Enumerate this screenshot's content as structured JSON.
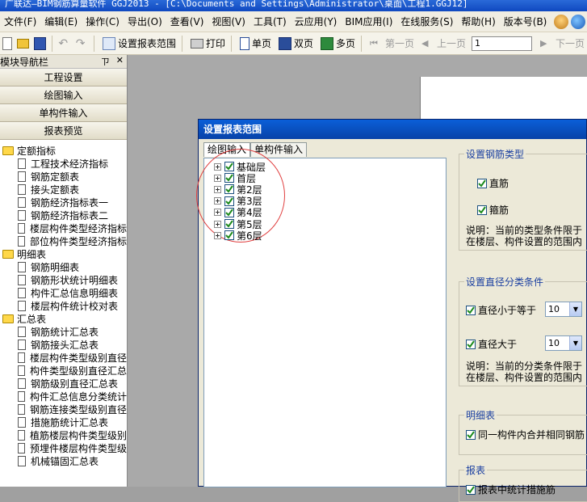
{
  "window": {
    "title": "广联达—BIM钢筋算量软件 GGJ2013 - [C:\\Documents and Settings\\Administrator\\桌面\\工程1.GGJ12]"
  },
  "menu": [
    "文件(F)",
    "编辑(E)",
    "操作(C)",
    "导出(O)",
    "查看(V)",
    "视图(V)",
    "工具(T)",
    "云应用(Y)",
    "BIM应用(I)",
    "在线服务(S)",
    "帮助(H)",
    "版本号(B)"
  ],
  "toolbar": {
    "set_range": "设置报表范围",
    "print": "打印",
    "single_page": "单页",
    "double_page": "双页",
    "multi_page": "多页",
    "first_page": "第一页",
    "prev_page": "上一页",
    "page_number": "1",
    "next_page": "下一页"
  },
  "nav": {
    "title": "模块导航栏",
    "pin": "ㄗ",
    "close": "✕",
    "buttons": [
      "工程设置",
      "绘图输入",
      "单构件输入",
      "报表预览"
    ],
    "tree": [
      {
        "type": "folder",
        "label": "定额指标"
      },
      {
        "type": "leaf",
        "label": "工程技术经济指标"
      },
      {
        "type": "leaf",
        "label": "钢筋定额表"
      },
      {
        "type": "leaf",
        "label": "接头定额表"
      },
      {
        "type": "leaf",
        "label": "钢筋经济指标表一"
      },
      {
        "type": "leaf",
        "label": "钢筋经济指标表二"
      },
      {
        "type": "leaf",
        "label": "楼层构件类型经济指标"
      },
      {
        "type": "leaf",
        "label": "部位构件类型经济指标"
      },
      {
        "type": "folder",
        "label": "明细表"
      },
      {
        "type": "leaf",
        "label": "钢筋明细表"
      },
      {
        "type": "leaf",
        "label": "钢筋形状统计明细表"
      },
      {
        "type": "leaf",
        "label": "构件汇总信息明细表"
      },
      {
        "type": "leaf",
        "label": "楼层构件统计校对表"
      },
      {
        "type": "folder",
        "label": "汇总表"
      },
      {
        "type": "leaf",
        "label": "钢筋统计汇总表"
      },
      {
        "type": "leaf",
        "label": "钢筋接头汇总表"
      },
      {
        "type": "leaf",
        "label": "楼层构件类型级别直径"
      },
      {
        "type": "leaf",
        "label": "构件类型级别直径汇总"
      },
      {
        "type": "leaf",
        "label": "钢筋级别直径汇总表"
      },
      {
        "type": "leaf",
        "label": "构件汇总信息分类统计"
      },
      {
        "type": "leaf",
        "label": "钢筋连接类型级别直径"
      },
      {
        "type": "leaf",
        "label": "措施筋统计汇总表"
      },
      {
        "type": "leaf",
        "label": "植筋楼层构件类型级别"
      },
      {
        "type": "leaf",
        "label": "预埋件楼层构件类型级"
      },
      {
        "type": "leaf",
        "label": "机械锚固汇总表"
      }
    ]
  },
  "dialog": {
    "title": "设置报表范围",
    "tabs": [
      "绘图输入",
      "单构件输入"
    ],
    "floors": [
      "基础层",
      "首层",
      "第2层",
      "第3层",
      "第4层",
      "第5层",
      "第6层"
    ],
    "rebar_type": {
      "title": "设置钢筋类型",
      "straight": "直筋",
      "stirrup": "箍筋",
      "note1": "说明：当前的类型条件限于",
      "note2": "在楼层、构件设置的范围内"
    },
    "diameter": {
      "title": "设置直径分类条件",
      "le_label": "直径小于等于",
      "le_value": "10",
      "gt_label": "直径大于",
      "gt_value": "10",
      "note1": "说明：当前的分类条件限于",
      "note2": "在楼层、构件设置的范围内"
    },
    "detail": {
      "title": "明细表",
      "merge": "同一构件内合并相同钢筋"
    },
    "report": {
      "title": "报表",
      "measure": "报表中统计措施筋"
    }
  },
  "colors": {
    "title_bar": "#0f48c0",
    "dialog_title": "#0a5fd8",
    "group_title": "#1a3fa0",
    "highlight_ellipse": "#e04040",
    "checkmark": "#1c8a1c"
  }
}
